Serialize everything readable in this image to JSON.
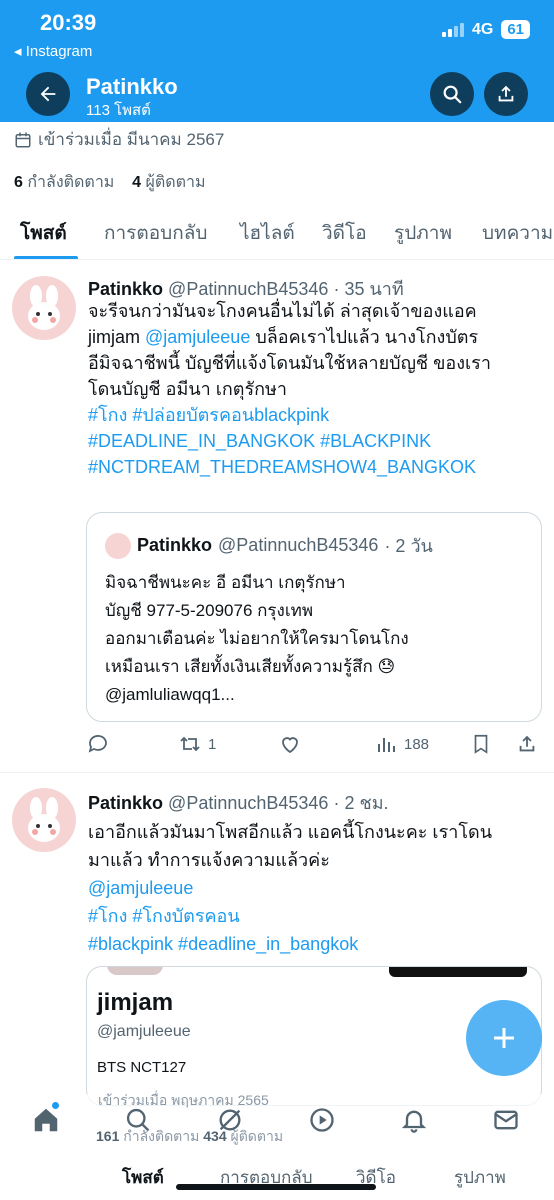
{
  "status_bar": {
    "time": "20:39",
    "back_app": "◂ Instagram",
    "network": "4G",
    "battery": "61"
  },
  "header": {
    "title": "Patinkko",
    "subtitle": "113 โพสต์"
  },
  "profile": {
    "joined": "เข้าร่วมเมื่อ มีนาคม 2567",
    "following_count": "6",
    "following_label": "กำลังติดตาม",
    "followers_count": "4",
    "followers_label": "ผู้ติดตาม"
  },
  "tabs": [
    "โพสต์",
    "การตอบกลับ",
    "ไฮไลต์",
    "วิดีโอ",
    "รูปภาพ",
    "บทความ"
  ],
  "tweet1": {
    "name": "Patinkko",
    "handle": "@PatinnuchB45346",
    "time": "· 35 นาที",
    "line1": "จะรีจนกว่ามันจะโกงคนอื่นไม่ได้ ล่าสุดเจ้าของแอค",
    "line2_pre": "jimjam ",
    "line2_mention": "@jamjuleeue",
    "line2_post": " บล็อคเราไปแล้ว นางโกงบัตร",
    "line3": "อีมิจฉาชีพนี้ บัญชีที่แจ้งโดนมันใช้หลายบัญชี ของเรา",
    "line4": "โดนบัญชี อมีนา เกตุรักษา",
    "tags1": "#โกง #ปล่อยบัตรคอนblackpink",
    "tags2": "#DEADLINE_IN_BANGKOK #BLACKPINK",
    "tags3": "#NCTDREAM_THEDREAMSHOW4_BANGKOK",
    "quote": {
      "name": "Patinkko",
      "handle": "@PatinnuchB45346",
      "time": "· 2 วัน",
      "line1": "มิจฉาชีพนะคะ อี อมีนา เกตุรักษา",
      "line2": "บัญชี 977-5-209076 กรุงเทพ",
      "line3": "ออกมาเตือนค่ะ ไม่อยากให้ใครมาโดนโกง",
      "line4": "เหมือนเรา เสียทั้งเงินเสียทั้งความรู้สึก 😓",
      "line5": "@jamluliawqq1..."
    },
    "retweets": "1",
    "views": "188"
  },
  "tweet2": {
    "name": "Patinkko",
    "handle": "@PatinnuchB45346",
    "time": "· 2 ชม.",
    "line1": "เอาอีกแล้วมันมาโพสอีกแล้ว แอคนี้โกงนะคะ เราโดน",
    "line2": "มาแล้ว ทำการแจ้งความแล้วค่ะ",
    "mention": "@jamjuleeue",
    "tags1": "#โกง #โกงบัตรคอน",
    "tags2": "#blackpink #deadline_in_bangkok",
    "embed": {
      "name": "jimjam",
      "handle": "@jamjuleeue",
      "bio": "BTS NCT127",
      "joined": "เข้าร่วมเมื่อ พฤษภาคม 2565",
      "following_count": "161",
      "following_label": "กำลังติดตาม",
      "followers_count": "434",
      "followers_label": "ผู้ติดตาม"
    }
  },
  "bottom_tabs": [
    "โพสต์",
    "การตอบกลับ",
    "วิดีโอ",
    "รูปภาพ"
  ],
  "icons": [
    "back-arrow-icon",
    "search-icon",
    "share-icon",
    "calendar-icon",
    "reply-icon",
    "retweet-icon",
    "like-icon",
    "views-icon",
    "bookmark-icon",
    "compose-plus-icon",
    "home-icon",
    "explore-icon",
    "spaces-icon",
    "notifications-icon",
    "messages-icon"
  ],
  "colors": {
    "accent": "#1d9bf0",
    "text": "#0f1419",
    "muted": "#536471"
  }
}
